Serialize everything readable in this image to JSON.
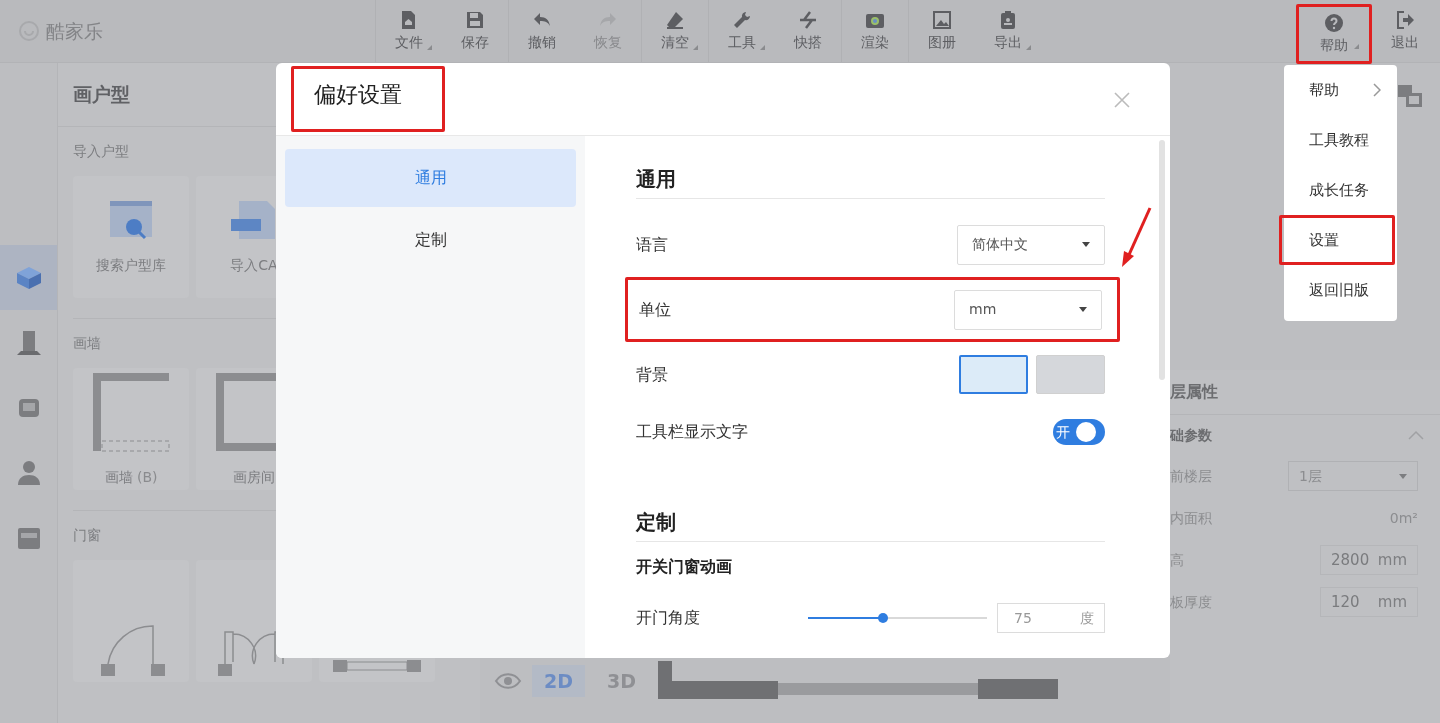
{
  "app": {
    "logo": "酷家乐"
  },
  "toolbar": {
    "groups": [
      [
        {
          "label": "文件",
          "dropdown": true,
          "disabled": false,
          "highlighted": false
        },
        {
          "label": "保存",
          "dropdown": false,
          "disabled": false,
          "highlighted": false
        }
      ],
      [
        {
          "label": "撤销",
          "dropdown": false,
          "disabled": false,
          "highlighted": false
        },
        {
          "label": "恢复",
          "dropdown": false,
          "disabled": true,
          "highlighted": false
        }
      ],
      [
        {
          "label": "清空",
          "dropdown": true,
          "disabled": false,
          "highlighted": false
        }
      ],
      [
        {
          "label": "工具",
          "dropdown": true,
          "disabled": false,
          "highlighted": false
        },
        {
          "label": "快搭",
          "dropdown": false,
          "disabled": false,
          "highlighted": false
        }
      ],
      [
        {
          "label": "渲染",
          "dropdown": false,
          "disabled": false,
          "highlighted": false
        }
      ],
      [
        {
          "label": "图册",
          "dropdown": false,
          "disabled": false,
          "highlighted": false
        },
        {
          "label": "导出",
          "dropdown": true,
          "disabled": false,
          "highlighted": false
        }
      ]
    ],
    "right": [
      {
        "label": "帮助",
        "dropdown": true,
        "disabled": false,
        "highlighted": true
      },
      {
        "label": "退出",
        "dropdown": false,
        "disabled": false,
        "highlighted": false
      }
    ]
  },
  "left_strip": {
    "items": [
      {
        "selected": true
      },
      {
        "selected": false
      },
      {
        "selected": false
      },
      {
        "selected": false
      },
      {
        "selected": false
      }
    ]
  },
  "left_panel": {
    "title": "画户型",
    "sections": [
      {
        "heading": "导入户型",
        "cards": [
          {
            "kind": "search",
            "label": "搜索户型库"
          },
          {
            "kind": "cad",
            "label": "导入CA"
          }
        ]
      },
      {
        "heading": "画墙",
        "cards": [
          {
            "kind": "wall",
            "label": "画墙",
            "hint": "(B)"
          },
          {
            "kind": "room",
            "label": "画房间"
          }
        ]
      },
      {
        "heading": "门窗",
        "cards": [
          {
            "kind": "door"
          },
          {
            "kind": "double-door"
          },
          {
            "kind": "window"
          }
        ]
      }
    ]
  },
  "canvas": {
    "view_tabs": [
      {
        "label": "2D",
        "selected": true
      },
      {
        "label": "3D",
        "selected": false
      }
    ]
  },
  "right_panel": {
    "title": "层属性",
    "group": {
      "title": "础参数",
      "expanded": true
    },
    "rows": [
      {
        "kind": "select",
        "label": "前楼层",
        "value": "1层"
      },
      {
        "kind": "text",
        "label": "内面积",
        "value": "0m²"
      },
      {
        "kind": "input",
        "label": "高",
        "value": "2800",
        "unit": "mm"
      },
      {
        "kind": "input",
        "label": "板厚度",
        "value": "120",
        "unit": "mm"
      }
    ]
  },
  "help_menu": {
    "items": [
      {
        "label": "帮助",
        "submenu": true,
        "highlighted": false
      },
      {
        "label": "工具教程",
        "submenu": false,
        "highlighted": false
      },
      {
        "label": "成长任务",
        "submenu": false,
        "highlighted": false
      },
      {
        "label": "设置",
        "submenu": false,
        "highlighted": true
      },
      {
        "label": "返回旧版",
        "submenu": false,
        "highlighted": false
      }
    ]
  },
  "dialog": {
    "title": "偏好设置",
    "title_highlighted": true,
    "nav": [
      {
        "label": "通用",
        "selected": true
      },
      {
        "label": "定制",
        "selected": false
      }
    ],
    "sections": [
      {
        "heading": "通用",
        "rows": [
          {
            "kind": "select",
            "label": "语言",
            "value": "简体中文",
            "highlighted": false
          },
          {
            "kind": "select",
            "label": "单位",
            "value": "mm",
            "highlighted": true
          },
          {
            "kind": "swatches",
            "label": "背景",
            "options": [
              {
                "color": "#dcebf8",
                "selected": true
              },
              {
                "color": "#d5d7db",
                "selected": false
              }
            ]
          },
          {
            "kind": "toggle",
            "label": "工具栏显示文字",
            "text": "开",
            "on": true
          }
        ]
      },
      {
        "heading": "定制",
        "subheading": "开关门窗动画",
        "rows": [
          {
            "kind": "slider",
            "label": "开门角度",
            "level": 0.42,
            "value": "75",
            "unit": "度"
          }
        ]
      }
    ]
  }
}
